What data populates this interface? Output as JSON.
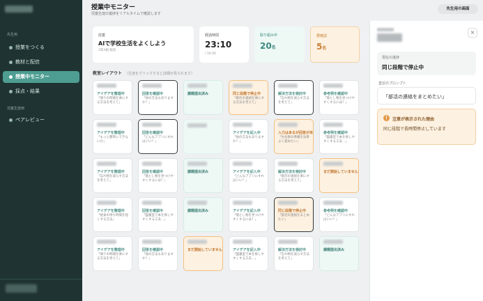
{
  "header": {
    "title": "授業中モニター",
    "subtitle": "児童生徒の進捗をリアルタイムで確認します",
    "top_button": "先生用の画面"
  },
  "sidebar": {
    "section1": "先生用",
    "items": [
      {
        "label": "授業をつくる",
        "active": false
      },
      {
        "label": "教材と配信",
        "active": false
      },
      {
        "label": "授業中モニター",
        "active": true
      },
      {
        "label": "採点・結果",
        "active": false
      }
    ],
    "section2": "児童生徒用",
    "items2": [
      {
        "label": "ペアレビュー",
        "active": false
      }
    ]
  },
  "stats": {
    "lesson": {
      "label": "授業",
      "title": "AIで学校生活をよくしよう",
      "class": "3年A組 総合"
    },
    "elapsed": {
      "label": "経過時間",
      "time": "23:10",
      "total": "/ 50:00"
    },
    "working": {
      "label": "取り組み中",
      "count": "20",
      "unit": "名"
    },
    "attention": {
      "label": "要確認",
      "count": "5",
      "unit": "名"
    }
  },
  "layout": {
    "title": "教室レイアウト",
    "hint": "（生徒をクリックすると詳細が見られます）"
  },
  "seats": [
    [
      {
        "status": "アイデアを整理中",
        "quote": "「帰りの時間を楽にする方法を考えて」",
        "variant": "normal"
      },
      {
        "status": "回答を確認中",
        "quote": "「他の方法もありますか？」",
        "variant": "dark"
      },
      {
        "status": "課題提出済み",
        "quote": "",
        "variant": "done"
      },
      {
        "status": "同じ段階で停止中",
        "quote": "「掲示の連絡を楽にする方法を考えて」",
        "variant": "alert"
      },
      {
        "status": "解決方法を検討中",
        "quote": "「忘れ物を減らす方法を考えて」",
        "variant": "dark"
      },
      {
        "status": "参考例を確認中",
        "quote": "「落とし物を見つけやすくするには？」",
        "variant": "normal"
      }
    ],
    [
      {
        "status": "アイデアを整理中",
        "quote": "「もっと簡単にできないか」",
        "variant": "normal"
      },
      {
        "status": "回答を確認中",
        "quote": "「どんなアプリにすればいい？」",
        "variant": "dark"
      },
      {
        "status": "",
        "quote": "",
        "variant": "mint"
      },
      {
        "status": "アイデアを記入中",
        "quote": "「他の方法もありますか？」",
        "variant": "normal"
      },
      {
        "status": "入力はあるが回答が未進行",
        "quote": "「文化祭の準備を効率よく進めたい」",
        "variant": "alert"
      },
      {
        "status": "参考例を確認中",
        "quote": "「図書室で本を探しやすくする工夫…」",
        "variant": "normal"
      }
    ],
    [
      {
        "status": "アイデアを整理中",
        "quote": "「忘れ物を減らす方法を考えて」",
        "variant": "normal"
      },
      {
        "status": "回答を確認中",
        "quote": "「落とし物を見つけやすくするには？」",
        "variant": "normal"
      },
      {
        "status": "課題提出済み",
        "quote": "",
        "variant": "done"
      },
      {
        "status": "アイデアを記入中",
        "quote": "「どんなアプリにすればいい？」",
        "variant": "normal"
      },
      {
        "status": "解決方法を検討中",
        "quote": "「掲示の連絡を楽にする方法を考えて」",
        "variant": "normal"
      },
      {
        "status": "まだ開始していません",
        "quote": "",
        "variant": "alert"
      }
    ],
    [
      {
        "status": "アイデアを整理中",
        "quote": "「給食の待ち時間を短くする方法」",
        "variant": "normal"
      },
      {
        "status": "回答を確認中",
        "quote": "「図書室で本を探しやすくする工夫…」",
        "variant": "normal"
      },
      {
        "status": "課題提出済み",
        "quote": "",
        "variant": "done"
      },
      {
        "status": "アイデアを記入中",
        "quote": "「落とし物を見つけやすくするには？」",
        "variant": "normal"
      },
      {
        "status": "同じ段階で停止中",
        "quote": "「部活の連絡をまとめたい」",
        "variant": "alert-dark"
      },
      {
        "status": "参考例を確認中",
        "quote": "「どんなアプリにすればいい？」",
        "variant": "normal"
      }
    ],
    [
      {
        "status": "アイデアを整理中",
        "quote": "「帰りの時間を楽にする方法を考えて」",
        "variant": "normal"
      },
      {
        "status": "回答を確認中",
        "quote": "「他の方法もありますか？」",
        "variant": "normal"
      },
      {
        "status": "まだ開始していません",
        "quote": "",
        "variant": "alert"
      },
      {
        "status": "アイデアを記入中",
        "quote": "「図書室で本を探しやすくする工夫…」",
        "variant": "normal"
      },
      {
        "status": "解決方法を検討中",
        "quote": "「忘れ物を減らす方法を考えて」",
        "variant": "normal"
      },
      {
        "status": "課題提出済み",
        "quote": "",
        "variant": "done"
      }
    ]
  ],
  "detail": {
    "current_stage_label": "現在の進捗",
    "current_stage": "同じ段階で停止中",
    "prompt_label": "直近のプロンプト",
    "prompt": "「部活の連絡をまとめたい」",
    "alert_icon": "!",
    "alert_title": "注意が表示された理由",
    "alert_text": "同じ段階で長時間停止しています",
    "close_glyph": "×"
  },
  "colors": {
    "sidebar_bg": "#1f3432",
    "accent": "#4e9d93",
    "alert": "#f1bf82"
  }
}
